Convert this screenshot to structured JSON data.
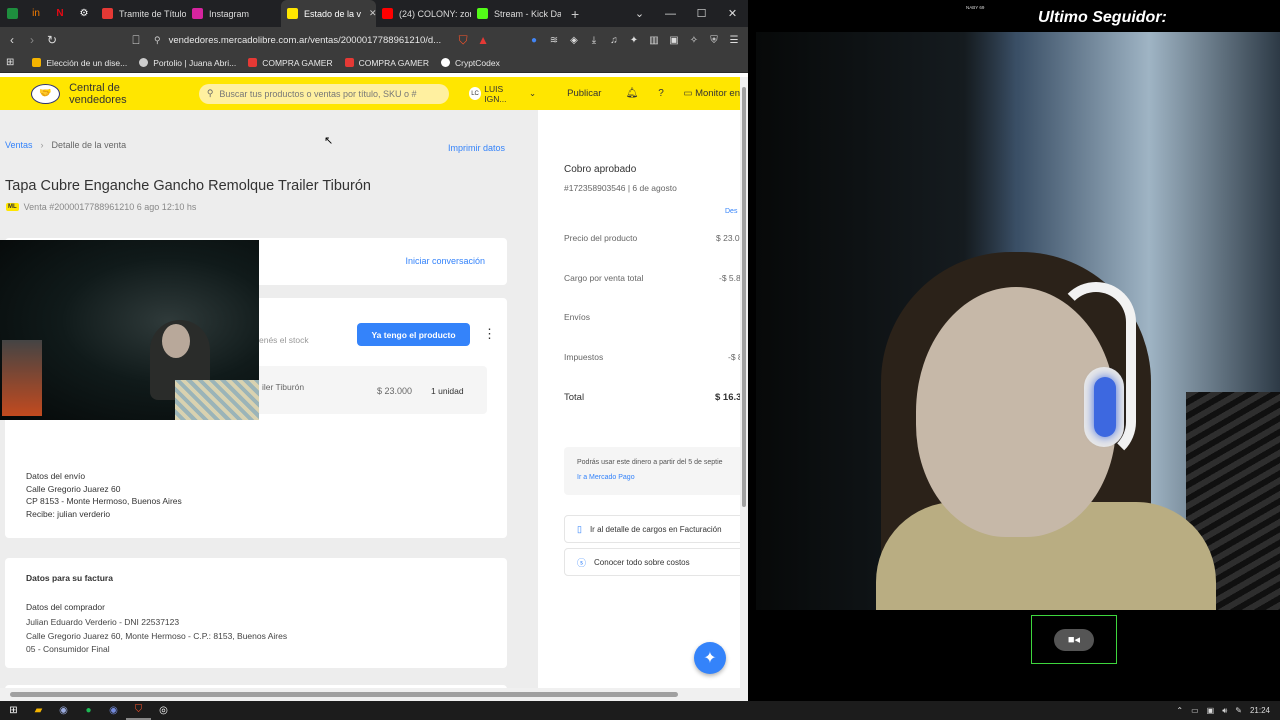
{
  "browser": {
    "tabs": [
      {
        "label": "Tramite de Título T",
        "color": "#e53935"
      },
      {
        "label": "Instagram",
        "color": "#d6249f"
      },
      {
        "label": "Estado de la v",
        "color": "#ffe600",
        "active": true
      },
      {
        "label": "(24) COLONY: zom",
        "color": "#ff0000"
      },
      {
        "label": "Stream - Kick Das",
        "color": "#53fc18"
      }
    ],
    "url": "vendedores.mercadolibre.com.ar/ventas/2000017788961210/d...",
    "bookmarks": [
      {
        "label": "Elección de un dise...",
        "color": "#f5b400"
      },
      {
        "label": "Portolio | Juana Abri...",
        "color": "#cccccc"
      },
      {
        "label": "COMPRA GAMER",
        "color": "#e53935"
      },
      {
        "label": "COMPRA GAMER",
        "color": "#e53935"
      },
      {
        "label": "CryptCodex",
        "color": "#222222"
      }
    ]
  },
  "ml": {
    "header_title": "Central de vendedores",
    "search_placeholder": "Buscar tus productos o ventas por título, SKU o #",
    "user_initials": "LC",
    "user_name": "LUIS IGN...",
    "publish": "Publicar",
    "monitor": "Monitor en"
  },
  "sale": {
    "breadcrumb_root": "Ventas",
    "breadcrumb_current": "Detalle de la venta",
    "print": "Imprimir datos",
    "title": "Tapa Cubre Enganche Gancho Remolque Trailer Tiburón",
    "badge": "ML",
    "sale_info": "Venta #2000017788961210 6 ago 12:10 hs",
    "start_conversation": "Iniciar conversación",
    "stock_text": "enés el stock",
    "have_product": "Ya tengo el producto",
    "item_name_partial": "iler Tiburón",
    "item_price": "$ 23.000",
    "item_units": "1 unidad",
    "shipping": {
      "title": "Datos del envío",
      "address": "Calle Gregorio Juarez 60",
      "city": "CP 8153 - Monte Hermoso, Buenos Aires",
      "receiver": "Recibe: julian verderio"
    },
    "invoice": {
      "title": "Datos para su factura",
      "buyer_title": "Datos del comprador",
      "buyer_name": "Julian Eduardo Verderio - DNI 22537123",
      "buyer_address": "Calle Gregorio Juarez 60, Monte Hermoso - C.P.: 8153, Buenos Aires",
      "tax": "05 - Consumidor Final"
    }
  },
  "payment": {
    "status": "Cobro aprobado",
    "id": "#172358903546 | 6 de agosto",
    "desc_link": "Des",
    "rows": [
      {
        "label": "Precio del producto",
        "value": "$ 23.0"
      },
      {
        "label": "Cargo por venta total",
        "value": "-$ 5.8"
      },
      {
        "label": "Envíos",
        "value": ""
      },
      {
        "label": "Impuestos",
        "value": "-$ 8"
      }
    ],
    "total_label": "Total",
    "total_value": "$ 16.3",
    "notice": "Podrás usar este dinero a partir del 5 de septie",
    "notice_link": "Ir a Mercado Pago",
    "link_billing": "Ir al detalle de cargos en Facturación",
    "link_costs": "Conocer todo sobre costos"
  },
  "stream": {
    "label": "Ultimo Seguidor:",
    "tiny": "NABY 69"
  },
  "taskbar": {
    "time": "21:24"
  }
}
